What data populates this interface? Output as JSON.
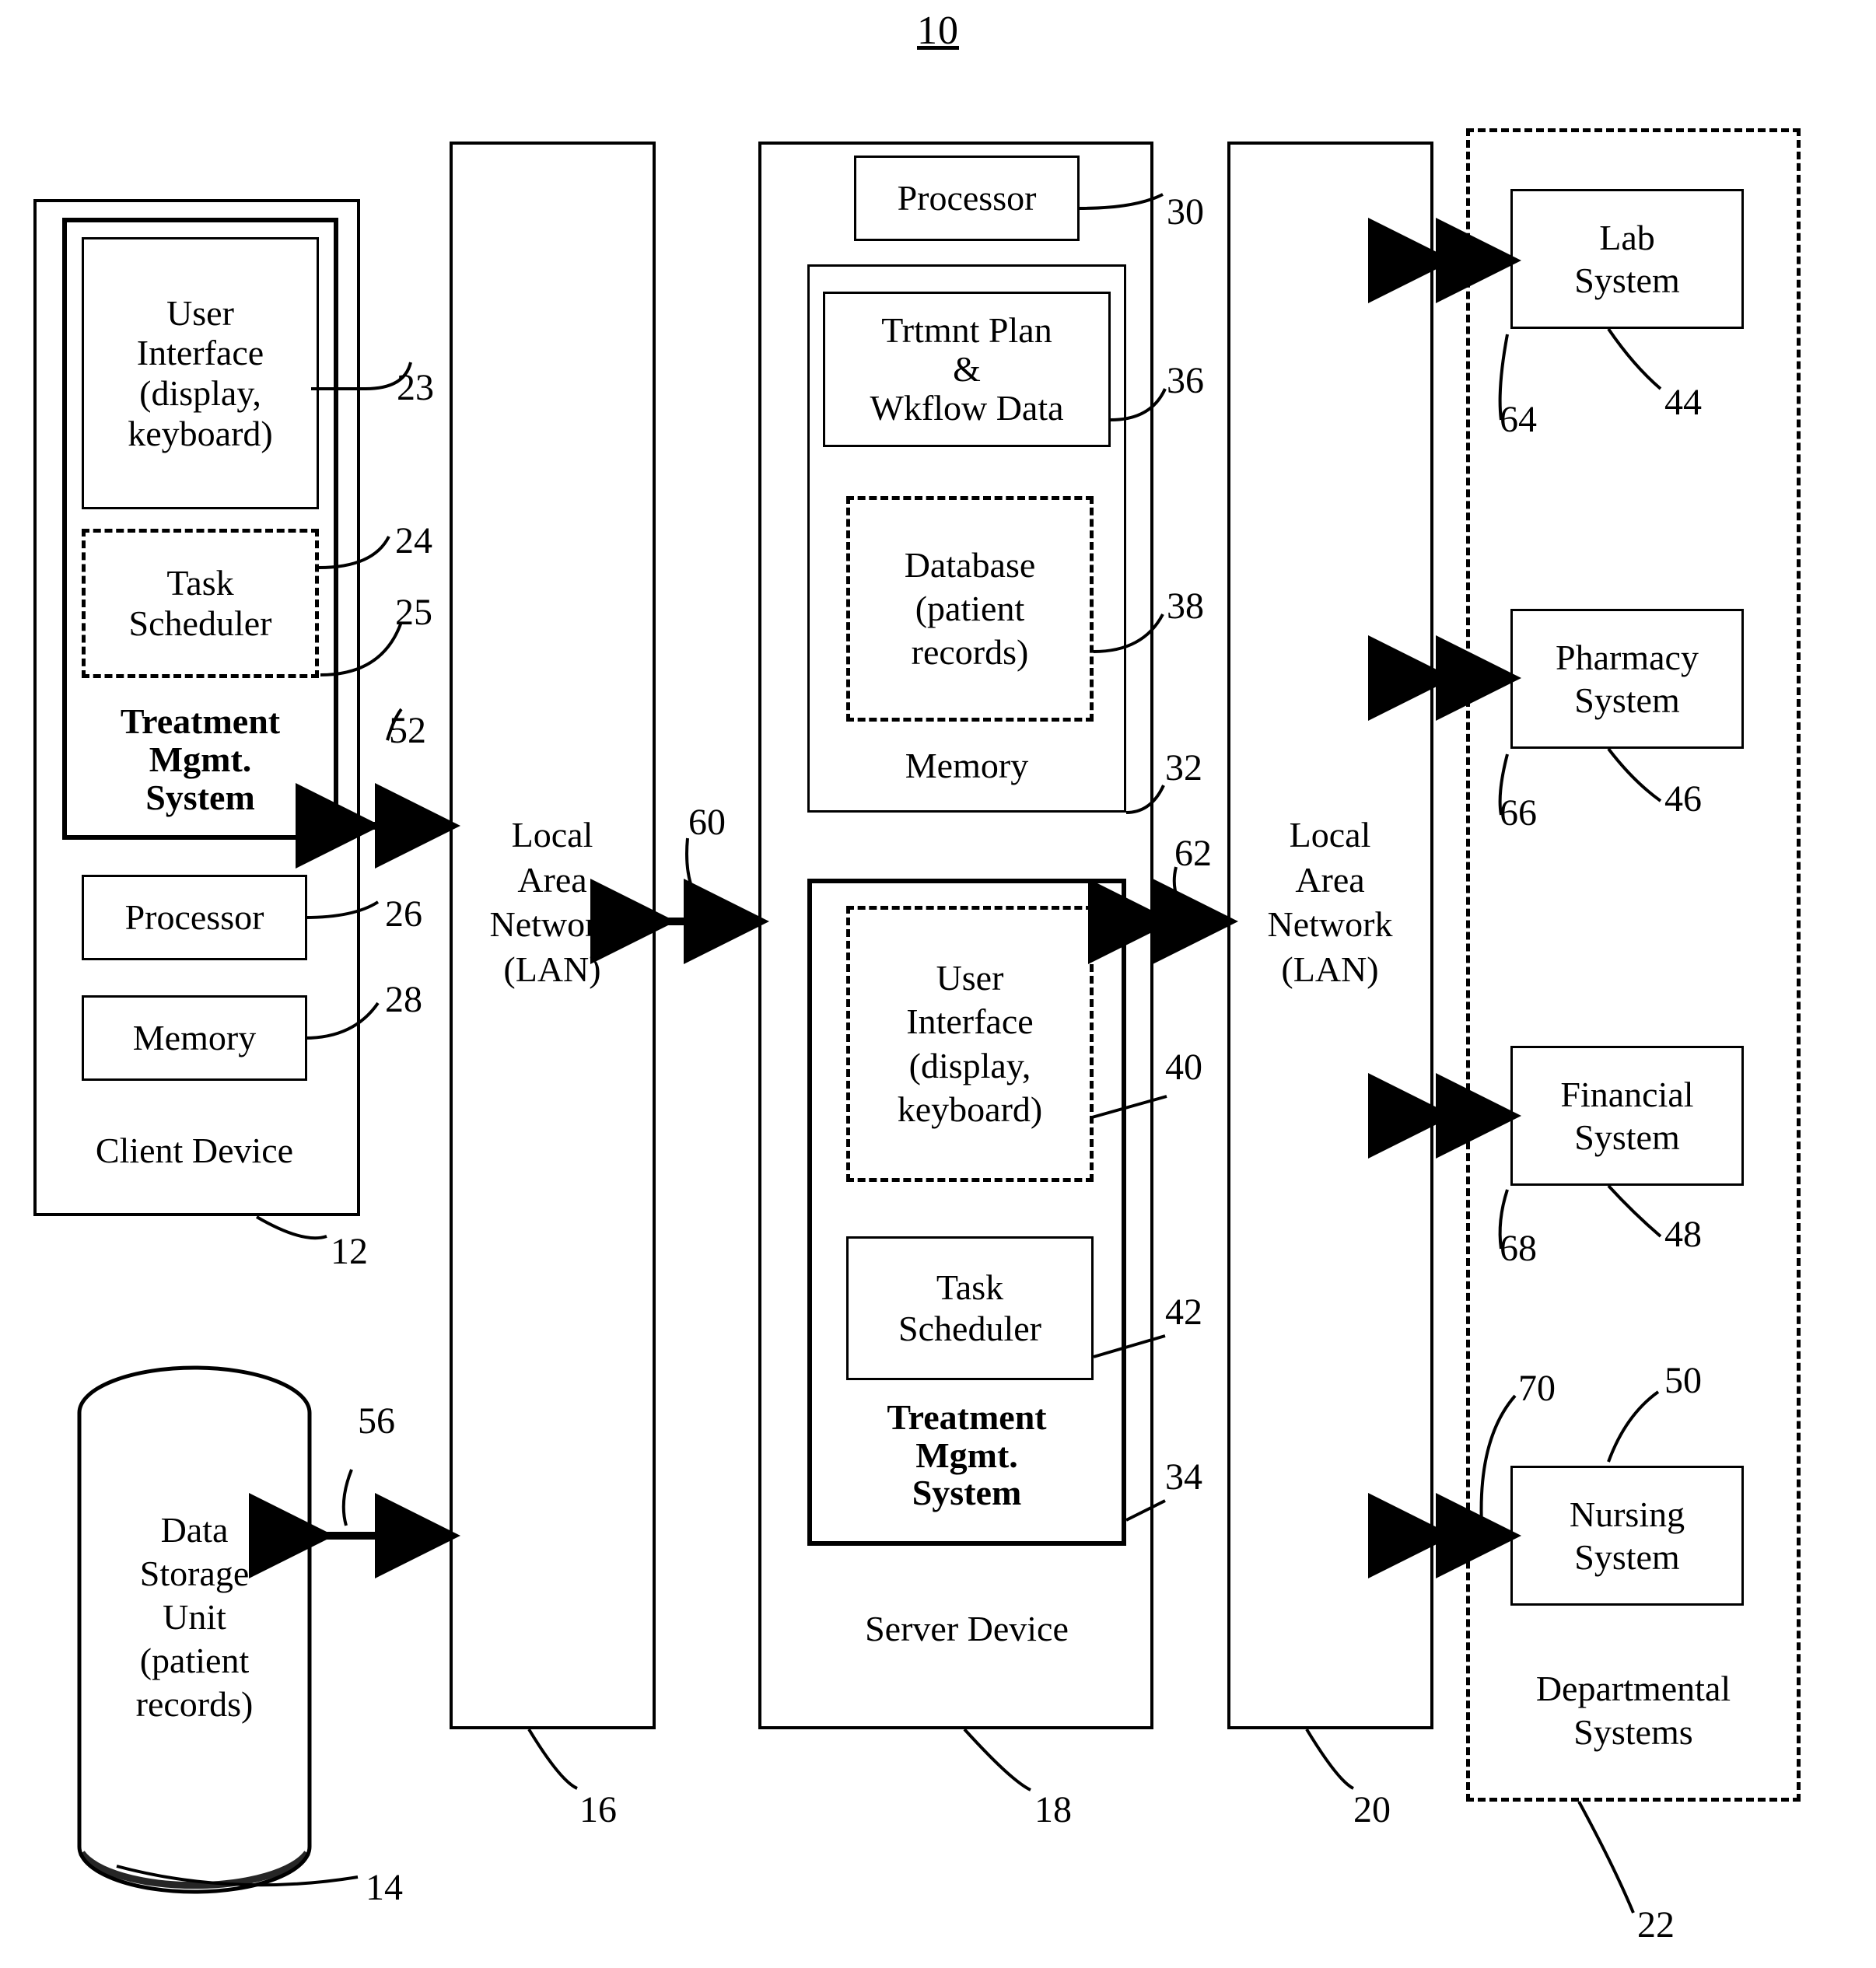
{
  "figure": {
    "number": "10"
  },
  "client": {
    "outer_label_line1": "Client",
    "outer_label_line2": "Device",
    "ref_outer": "12",
    "user_interface": "User\nInterface\n(display,\nkeyboard)",
    "ref_user_interface": "23",
    "task_scheduler": "Task\nScheduler",
    "ref_treatment_mgmt": "24",
    "ref_task_scheduler": "25",
    "treatment_mgmt": "Treatment\nMgmt.\nSystem",
    "processor": "Processor",
    "ref_processor": "26",
    "memory": "Memory",
    "ref_memory": "28",
    "ref_link_lan": "52"
  },
  "data_storage": {
    "label": "Data\nStorage\nUnit\n(patient\nrecords)",
    "ref": "14",
    "ref_link_lan": "56"
  },
  "lan_left": {
    "label": "Local\nArea\nNetwork\n(LAN)",
    "ref": "16"
  },
  "lan_right": {
    "label": "Local\nArea\nNetwork\n(LAN)",
    "ref": "20"
  },
  "links": {
    "lan_left_to_server": "60",
    "server_to_lan_right": "62"
  },
  "server": {
    "outer_label_line1": "Server",
    "outer_label_line2": "Device",
    "processor": "Processor",
    "ref_processor": "30",
    "treatment_plan": "Trtmnt Plan\n&\nWkflow Data",
    "ref_treatment_plan": "36",
    "database": "Database\n(patient\nrecords)",
    "ref_database": "38",
    "memory": "Memory",
    "ref_memory": "32",
    "user_interface": "User\nInterface\n(display,\nkeyboard)",
    "ref_user_interface": "40",
    "task_scheduler": "Task\nScheduler",
    "ref_task_scheduler": "42",
    "treatment_mgmt": "Treatment\nMgmt.\nSystem",
    "ref_treatment_mgmt": "34",
    "ref_outer": "18"
  },
  "departmental": {
    "label": "Departmental\nSystems",
    "ref": "22",
    "systems": [
      {
        "name": "Lab\nSystem",
        "ref": "44",
        "link_ref": "64"
      },
      {
        "name": "Pharmacy\nSystem",
        "ref": "46",
        "link_ref": "66"
      },
      {
        "name": "Financial\nSystem",
        "ref": "48",
        "link_ref": "68"
      },
      {
        "name": "Nursing\nSystem",
        "ref": "50",
        "link_ref": "70"
      }
    ]
  }
}
